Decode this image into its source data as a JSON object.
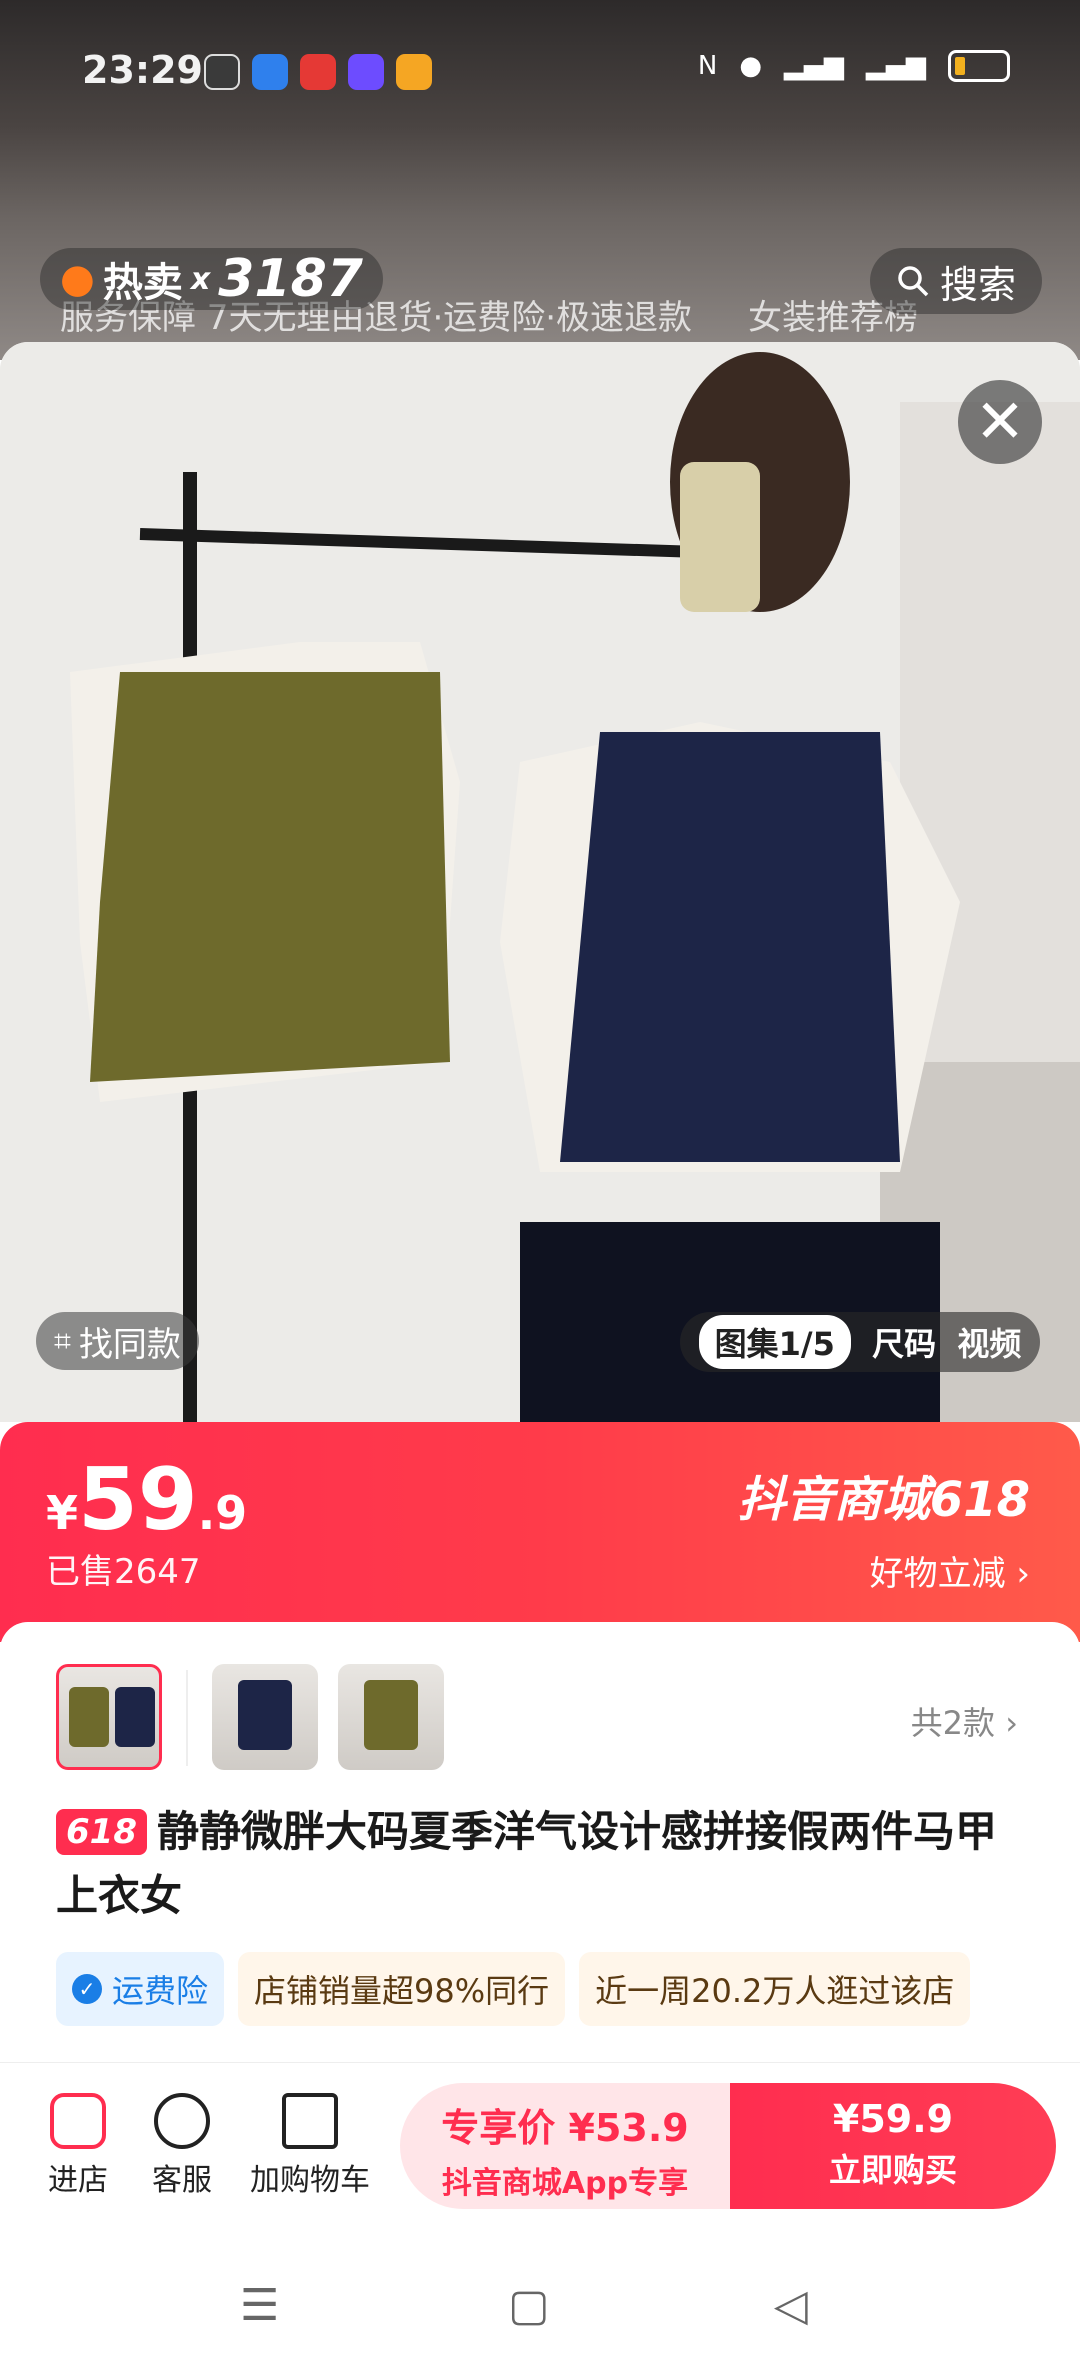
{
  "status_bar": {
    "time": "23:29"
  },
  "top_overlay": {
    "hot_label": "热卖",
    "hot_count_prefix": "x",
    "hot_count": "3187",
    "service_line": "服务保障  7天无理由退货·运费险·极速退款",
    "rank_label": "女装推荐榜",
    "search_label": "搜索"
  },
  "photo": {
    "find_same": "找同款",
    "tabs": [
      "图集1/5",
      "尺码",
      "视频"
    ]
  },
  "price_banner": {
    "currency": "¥",
    "price_int": "59",
    "price_dec": ".9",
    "sold": "已售2647",
    "mall": "抖音商城618",
    "discount_label": "好物立减",
    "colors": {
      "start": "#ff2d4f",
      "end": "#ff5a4a"
    }
  },
  "card": {
    "variants_total": "共2款",
    "tag": "618",
    "title": "静静微胖大码夏季洋气设计感拼接假两件马甲上衣女",
    "chips": [
      "运费险",
      "店铺销量超98%同行",
      "近一周20.2万人逛过该店"
    ]
  },
  "bottom_bar": {
    "nav": [
      "进店",
      "客服",
      "加购物车"
    ],
    "exclusive_price": "专享价 ¥53.9",
    "exclusive_sub": "抖音商城App专享",
    "buy_price": "¥59.9",
    "buy_label": "立即购买"
  }
}
